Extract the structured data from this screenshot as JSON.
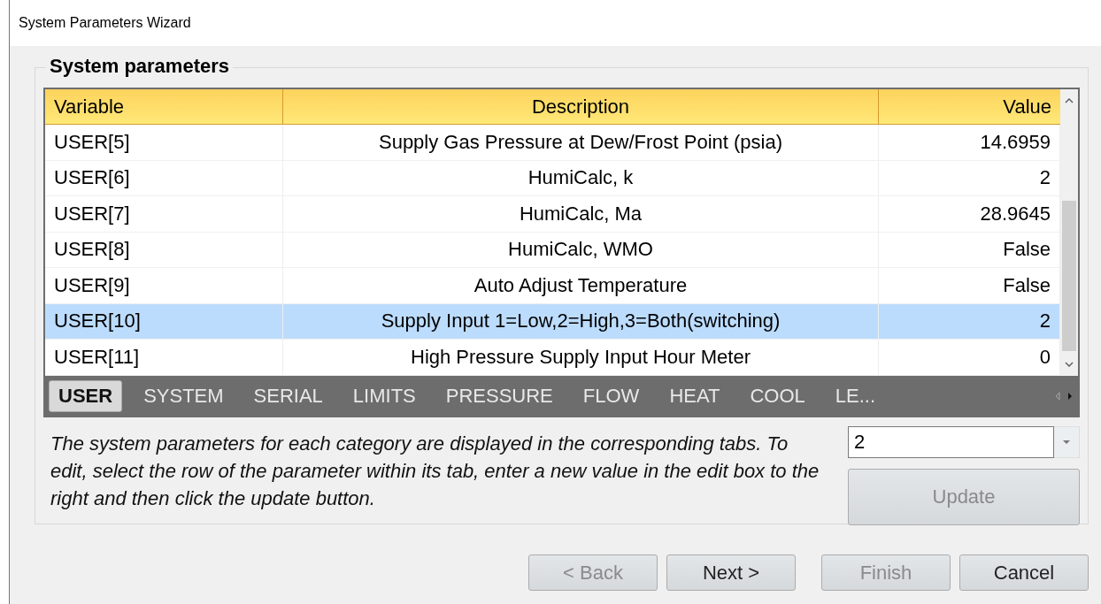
{
  "window": {
    "title": "System Parameters Wizard"
  },
  "group": {
    "title": "System parameters"
  },
  "table": {
    "columns": [
      {
        "label": "Variable"
      },
      {
        "label": "Description"
      },
      {
        "label": "Value"
      }
    ],
    "rows": [
      {
        "cells": [
          "USER[5]",
          "Supply Gas Pressure at Dew/Frost Point (psia)",
          "14.6959"
        ],
        "selected": false
      },
      {
        "cells": [
          "USER[6]",
          "HumiCalc, k",
          "2"
        ],
        "selected": false
      },
      {
        "cells": [
          "USER[7]",
          "HumiCalc, Ma",
          "28.9645"
        ],
        "selected": false
      },
      {
        "cells": [
          "USER[8]",
          "HumiCalc, WMO",
          "False"
        ],
        "selected": false
      },
      {
        "cells": [
          "USER[9]",
          "Auto Adjust Temperature",
          "False"
        ],
        "selected": false
      },
      {
        "cells": [
          "USER[10]",
          "Supply Input 1=Low,2=High,3=Both(switching)",
          "2"
        ],
        "selected": true
      },
      {
        "cells": [
          "USER[11]",
          "High Pressure Supply Input Hour Meter",
          "0"
        ],
        "selected": false
      }
    ]
  },
  "tabs": [
    {
      "label": "USER",
      "selected": true
    },
    {
      "label": "SYSTEM",
      "selected": false
    },
    {
      "label": "SERIAL",
      "selected": false
    },
    {
      "label": "LIMITS",
      "selected": false
    },
    {
      "label": "PRESSURE",
      "selected": false
    },
    {
      "label": "FLOW",
      "selected": false
    },
    {
      "label": "HEAT",
      "selected": false
    },
    {
      "label": "COOL",
      "selected": false
    },
    {
      "label": "LE...",
      "selected": false
    }
  ],
  "help_text": "The system parameters for each category are displayed in the corresponding tabs. To edit, select the row of the parameter within its tab, enter a new value in the edit box to the right and then click the update button.",
  "edit_box": {
    "value": "2"
  },
  "update_button": {
    "label": "Update",
    "disabled": true
  },
  "buttons": [
    {
      "label": "< Back",
      "disabled": true
    },
    {
      "label": "Next >",
      "disabled": false
    },
    {
      "label": "Finish",
      "disabled": true
    },
    {
      "label": "Cancel",
      "disabled": false
    }
  ]
}
